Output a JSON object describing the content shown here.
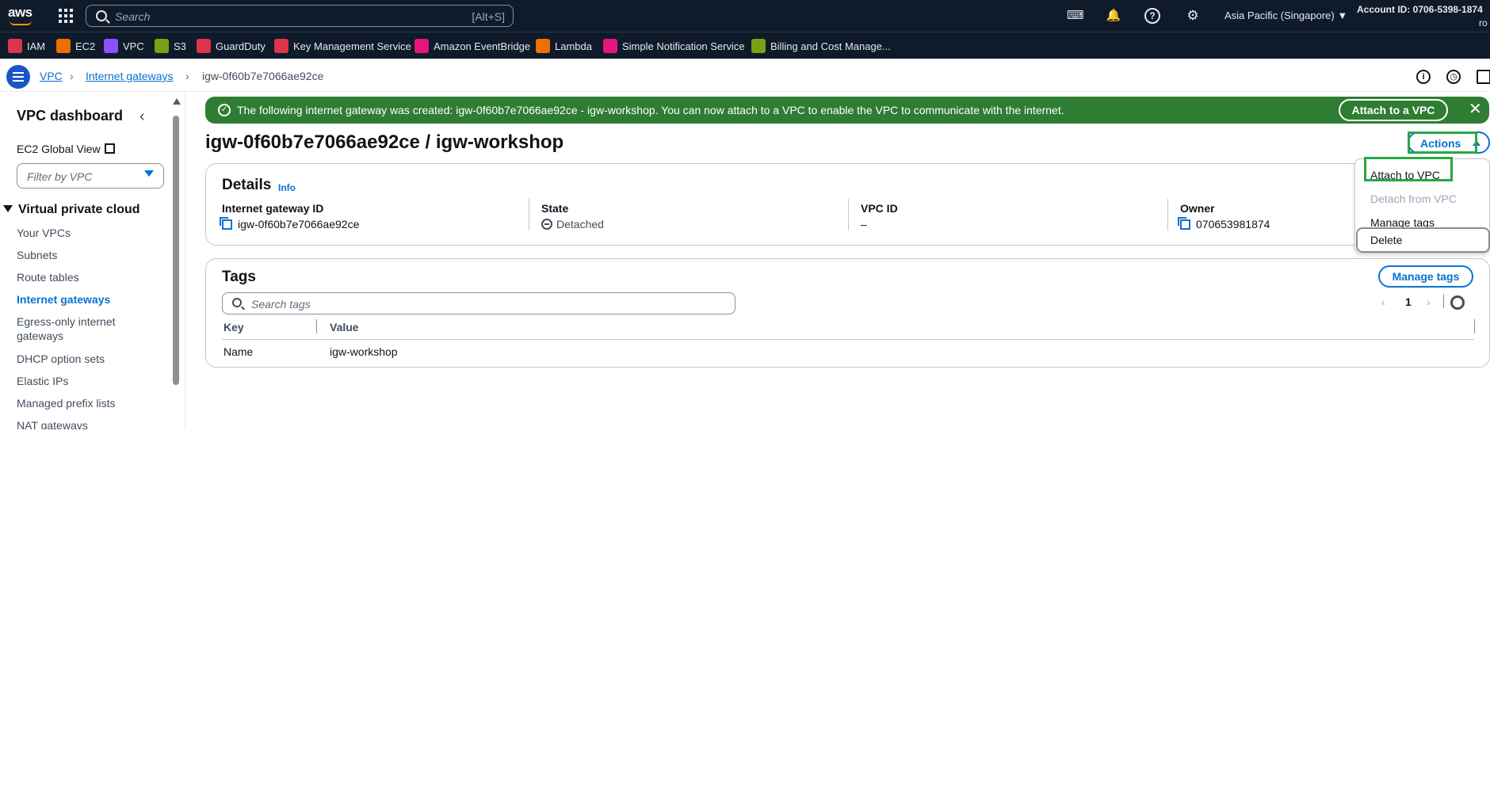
{
  "topnav": {
    "logo": "aws",
    "search_placeholder": "Search",
    "search_shortcut": "[Alt+S]",
    "region": "Asia Pacific (Singapore) ▼",
    "account": "Account ID: 0706-5398-1874",
    "role": "ro",
    "icons": [
      "cloudshell-icon",
      "bell-icon",
      "help-icon",
      "gear-icon"
    ]
  },
  "favorites": [
    {
      "label": "IAM",
      "color": "#dd344c"
    },
    {
      "label": "EC2",
      "color": "#ed7100"
    },
    {
      "label": "VPC",
      "color": "#8c4fff"
    },
    {
      "label": "S3",
      "color": "#7aa116"
    },
    {
      "label": "GuardDuty",
      "color": "#dd344c"
    },
    {
      "label": "Key Management Service",
      "color": "#dd344c"
    },
    {
      "label": "Amazon EventBridge",
      "color": "#e7157b"
    },
    {
      "label": "Lambda",
      "color": "#ed7100"
    },
    {
      "label": "Simple Notification Service",
      "color": "#e7157b"
    },
    {
      "label": "Billing and Cost Manage...",
      "color": "#7aa116"
    }
  ],
  "breadcrumb": {
    "items": [
      "VPC",
      "Internet gateways",
      "igw-0f60b7e7066ae92ce"
    ]
  },
  "sidebar": {
    "title": "VPC dashboard",
    "global_view": "EC2 Global View",
    "filter_placeholder": "Filter by VPC",
    "section": "Virtual private cloud",
    "items": [
      {
        "label": "Your VPCs"
      },
      {
        "label": "Subnets"
      },
      {
        "label": "Route tables"
      },
      {
        "label": "Internet gateways",
        "active": true
      },
      {
        "label": "Egress-only internet gateways"
      },
      {
        "label": "DHCP option sets"
      },
      {
        "label": "Elastic IPs"
      },
      {
        "label": "Managed prefix lists"
      },
      {
        "label": "NAT gateways"
      }
    ]
  },
  "flash": {
    "message": "The following internet gateway was created: igw-0f60b7e7066ae92ce - igw-workshop. You can now attach to a VPC to enable the VPC to communicate with the internet.",
    "action": "Attach to a VPC",
    "color": "#2f7d32"
  },
  "page": {
    "title": "igw-0f60b7e7066ae92ce / igw-workshop",
    "actions_label": "Actions"
  },
  "actions_menu": {
    "items": [
      {
        "label": "Attach to VPC",
        "disabled": false
      },
      {
        "label": "Detach from VPC",
        "disabled": true
      },
      {
        "label": "Manage tags",
        "disabled": false
      },
      {
        "label": "Delete",
        "disabled": false
      }
    ]
  },
  "details": {
    "title": "Details",
    "info": "Info",
    "fields": [
      {
        "key": "Internet gateway ID",
        "value": "igw-0f60b7e7066ae92ce"
      },
      {
        "key": "State",
        "value": "Detached"
      },
      {
        "key": "VPC ID",
        "value": "–"
      },
      {
        "key": "Owner",
        "value": "070653981874"
      }
    ]
  },
  "tags": {
    "title": "Tags",
    "manage_label": "Manage tags",
    "search_placeholder": "Search tags",
    "page": "1",
    "columns": [
      "Key",
      "Value"
    ],
    "rows": [
      {
        "key": "Name",
        "value": "igw-workshop"
      }
    ]
  },
  "highlight_color": "#28a745"
}
